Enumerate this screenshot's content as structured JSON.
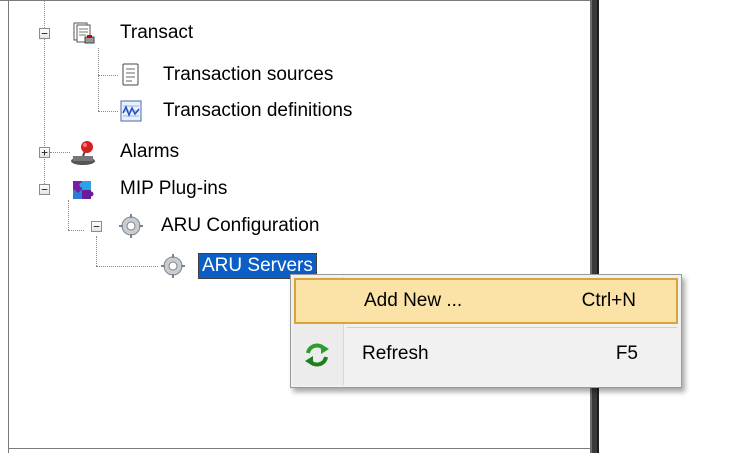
{
  "tree": {
    "transact": {
      "label": "Transact",
      "expander": "−"
    },
    "transaction_sources": {
      "label": "Transaction sources"
    },
    "transaction_definitions": {
      "label": "Transaction definitions"
    },
    "alarms": {
      "label": "Alarms",
      "expander": "+"
    },
    "mip_plugins": {
      "label": "MIP Plug-ins",
      "expander": "−"
    },
    "aru_configuration": {
      "label": "ARU Configuration",
      "expander": "−"
    },
    "aru_servers": {
      "label": "ARU Servers"
    }
  },
  "context_menu": {
    "items": [
      {
        "label": "Add New ...",
        "shortcut": "Ctrl+N",
        "icon": "none",
        "highlighted": true
      },
      {
        "label": "Refresh",
        "shortcut": "F5",
        "icon": "refresh-icon",
        "highlighted": false
      }
    ]
  },
  "colors": {
    "selection": "#0b5fc4",
    "menu_hover": "#fbe3a7",
    "menu_hover_border": "#d9a43b",
    "refresh_green": "#2e9d2e"
  }
}
